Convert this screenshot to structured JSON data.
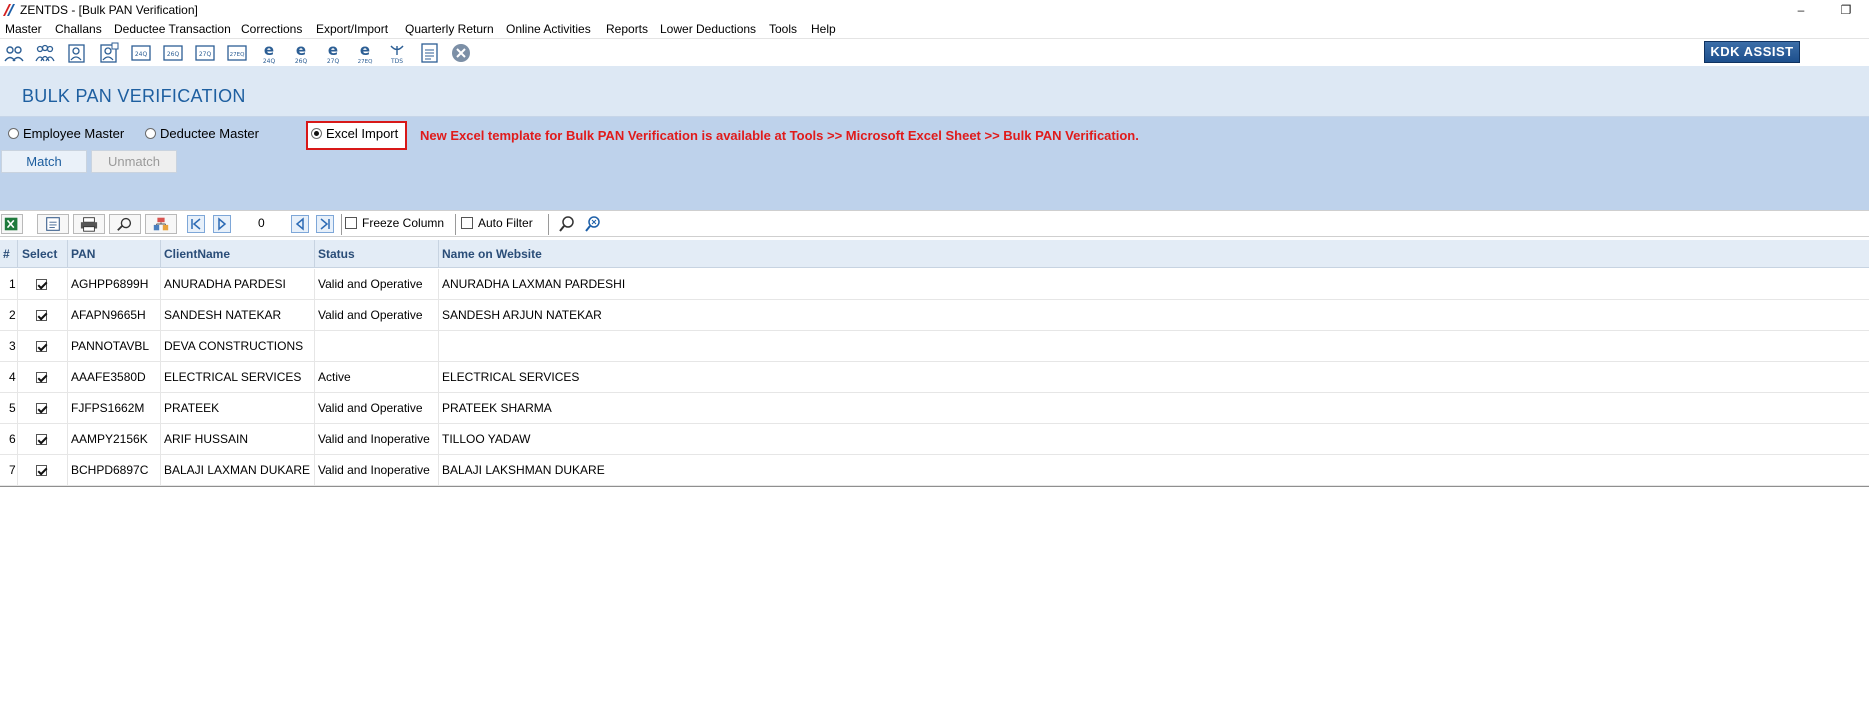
{
  "window": {
    "title": "ZENTDS - [Bulk PAN Verification]",
    "restore_glyph": "❐",
    "minimize_glyph": "–"
  },
  "menu": [
    "Master",
    "Challans",
    "Deductee Transaction",
    "Corrections",
    "Export/Import",
    "Quarterly Return",
    "Online Activities",
    "Reports",
    "Lower Deductions",
    "Tools",
    "Help"
  ],
  "toolbar": {
    "icons": [
      "users-icon",
      "group-icon",
      "employee-icon",
      "deductee-icon",
      "form-24q-icon",
      "form-26q-icon",
      "form-27q-icon",
      "form-27eq-icon",
      "e-24q-icon",
      "e-26q-icon",
      "e-27q-icon",
      "e-27eq-icon",
      "tds-icon",
      "report-icon",
      "close-icon"
    ],
    "icon_labels": [
      "",
      "",
      "",
      "",
      "24Q",
      "26Q",
      "27Q",
      "27EQ",
      "24Q",
      "26Q",
      "27Q",
      "27EQ",
      "TDS",
      "",
      ""
    ],
    "kdk_assist": "KDK ASSIST"
  },
  "page": {
    "title": "BULK PAN VERIFICATION"
  },
  "options": {
    "employee_master": "Employee Master",
    "deductee_master": "Deductee Master",
    "excel_import": "Excel Import",
    "selected": "Excel Import",
    "notice": "New Excel template for Bulk PAN Verification is available at Tools >> Microsoft Excel Sheet >> Bulk PAN Verification.",
    "match": "Match",
    "unmatch": "Unmatch"
  },
  "gridbar": {
    "count": "0",
    "freeze_column": "Freeze Column",
    "auto_filter": "Auto Filter"
  },
  "table": {
    "columns": [
      "#",
      "Select",
      "PAN",
      "ClientName",
      "Status",
      "Name on Website"
    ],
    "rows": [
      {
        "n": "1",
        "selected": true,
        "pan": "AGHPP6899H",
        "client": "ANURADHA PARDESI",
        "status": "Valid and Operative",
        "website": "ANURADHA LAXMAN PARDESHI"
      },
      {
        "n": "2",
        "selected": true,
        "pan": "AFAPN9665H",
        "client": "SANDESH NATEKAR",
        "status": "Valid and Operative",
        "website": "SANDESH ARJUN NATEKAR"
      },
      {
        "n": "3",
        "selected": true,
        "pan": "PANNOTAVBL",
        "client": "DEVA CONSTRUCTIONS",
        "status": "",
        "website": ""
      },
      {
        "n": "4",
        "selected": true,
        "pan": "AAAFE3580D",
        "client": "ELECTRICAL SERVICES",
        "status": "Active",
        "website": "ELECTRICAL SERVICES"
      },
      {
        "n": "5",
        "selected": true,
        "pan": "FJFPS1662M",
        "client": "PRATEEK",
        "status": "Valid and Operative",
        "website": "PRATEEK SHARMA"
      },
      {
        "n": "6",
        "selected": true,
        "pan": "AAMPY2156K",
        "client": "ARIF HUSSAIN",
        "status": "Valid and Inoperative",
        "website": "TILLOO YADAW"
      },
      {
        "n": "7",
        "selected": true,
        "pan": "BCHPD6897C",
        "client": "BALAJI LAXMAN DUKARE",
        "status": "Valid and Inoperative",
        "website": "BALAJI LAKSHMAN DUKARE"
      }
    ]
  },
  "colors": {
    "accent": "#1e5fa0",
    "panel": "#bed2eb",
    "header_band": "#dde8f4",
    "highlight": "#d81818"
  }
}
